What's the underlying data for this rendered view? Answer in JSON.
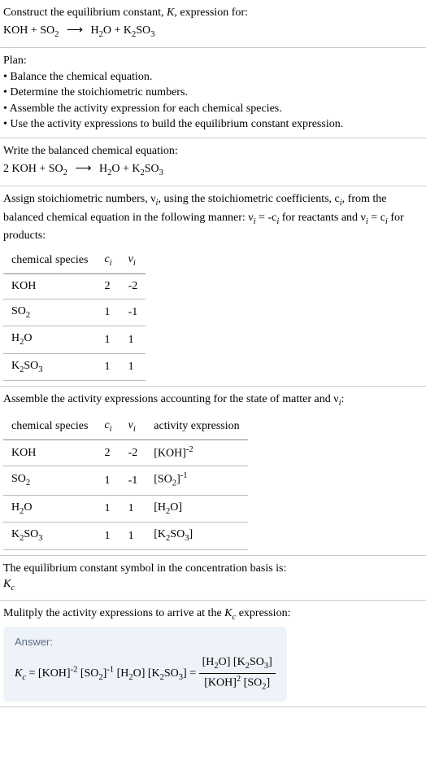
{
  "prompt": {
    "title": "Construct the equilibrium constant, K, expression for:",
    "equation_lhs1": "KOH",
    "equation_lhs2": "SO",
    "equation_lhs2_sub": "2",
    "equation_rhs1": "H",
    "equation_rhs1_sub": "2",
    "equation_rhs1b": "O",
    "equation_rhs2": "K",
    "equation_rhs2_sub": "2",
    "equation_rhs2b": "SO",
    "equation_rhs2b_sub": "3"
  },
  "plan": {
    "title": "Plan:",
    "items": [
      "Balance the chemical equation.",
      "Determine the stoichiometric numbers.",
      "Assemble the activity expression for each chemical species.",
      "Use the activity expressions to build the equilibrium constant expression."
    ]
  },
  "balanced": {
    "title": "Write the balanced chemical equation:",
    "coef1": "2",
    "species1": "KOH",
    "species2": "SO",
    "species2_sub": "2",
    "prod1a": "H",
    "prod1a_sub": "2",
    "prod1b": "O",
    "prod2a": "K",
    "prod2a_sub": "2",
    "prod2b": "SO",
    "prod2b_sub": "3"
  },
  "assign": {
    "text_a": "Assign stoichiometric numbers, ν",
    "text_b": ", using the stoichiometric coefficients, c",
    "text_c": ", from the balanced chemical equation in the following manner: ν",
    "text_d": " = -c",
    "text_e": " for reactants and ν",
    "text_f": " = c",
    "text_g": " for products:",
    "sub_i": "i"
  },
  "table1": {
    "h1": "chemical species",
    "h2": "c",
    "h3": "ν",
    "sub_i": "i",
    "rows": [
      {
        "sp": "KOH",
        "c": "2",
        "v": "-2"
      },
      {
        "sp": "SO₂",
        "c": "1",
        "v": "-1"
      },
      {
        "sp": "H₂O",
        "c": "1",
        "v": "1"
      },
      {
        "sp": "K₂SO₃",
        "c": "1",
        "v": "1"
      }
    ]
  },
  "assemble": {
    "text_a": "Assemble the activity expressions accounting for the state of matter and ν",
    "sub_i": "i",
    "text_b": ":"
  },
  "table2": {
    "h1": "chemical species",
    "h2": "c",
    "h3": "ν",
    "h4": "activity expression",
    "sub_i": "i",
    "rows": [
      {
        "sp": "KOH",
        "c": "2",
        "v": "-2",
        "a": "[KOH]",
        "exp": "-2"
      },
      {
        "sp": "SO₂",
        "c": "1",
        "v": "-1",
        "a": "[SO₂]",
        "exp": "-1"
      },
      {
        "sp": "H₂O",
        "c": "1",
        "v": "1",
        "a": "[H₂O]",
        "exp": ""
      },
      {
        "sp": "K₂SO₃",
        "c": "1",
        "v": "1",
        "a": "[K₂SO₃]",
        "exp": ""
      }
    ]
  },
  "symbol": {
    "text": "The equilibrium constant symbol in the concentration basis is:",
    "K": "K",
    "sub_c": "c"
  },
  "multiply": {
    "text_a": "Mulitply the activity expressions to arrive at the ",
    "K": "K",
    "sub_c": "c",
    "text_b": " expression:"
  },
  "answer": {
    "label": "Answer:",
    "K": "K",
    "sub_c": "c",
    "eq": " = ",
    "t1": "[KOH]",
    "e1": "-2",
    "t2": " [SO",
    "t2sub": "2",
    "t2b": "]",
    "e2": "-1",
    "t3": " [H",
    "t3sub": "2",
    "t3b": "O] [K",
    "t3sub2": "2",
    "t3c": "SO",
    "t3sub3": "3",
    "t3d": "]",
    "eq2": " = ",
    "num_a": "[H",
    "num_a_sub": "2",
    "num_b": "O] [K",
    "num_b_sub": "2",
    "num_c": "SO",
    "num_c_sub": "3",
    "num_d": "]",
    "den_a": "[KOH]",
    "den_a_exp": "2",
    "den_b": " [SO",
    "den_b_sub": "2",
    "den_c": "]"
  }
}
